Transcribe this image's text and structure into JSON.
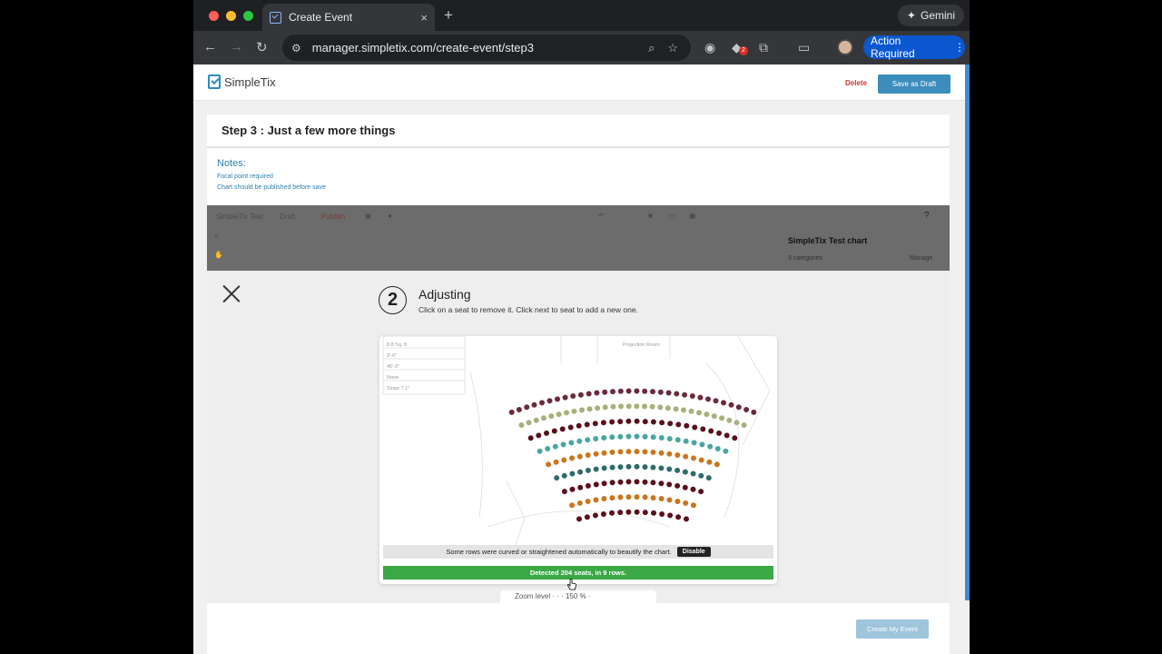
{
  "browser": {
    "tab_title": "Create Event",
    "tab_close": "×",
    "new_tab": "+",
    "gemini_label": "Gemini",
    "url": "manager.simpletix.com/create-event/step3",
    "extension_badge": "2",
    "action_required": "Action Required",
    "traffic_lights": [
      "#ff5f57",
      "#febc2e",
      "#28c840"
    ]
  },
  "header": {
    "logo_text": "SimpleTix",
    "delete_label": "Delete",
    "save_draft_label": "Save as Draft"
  },
  "step": {
    "title": "Step 3 : Just a few more things",
    "notes_heading": "Notes:",
    "notes": [
      "Focal point required",
      "Chart should be published before save"
    ]
  },
  "designer": {
    "app_name": "SimpleTix Test",
    "status": "Draft",
    "publish": "Publish",
    "chart_name": "SimpleTix Test chart",
    "categories": "3 categories",
    "manage": "Manage"
  },
  "wizard": {
    "step_number": "2",
    "title": "Adjusting",
    "subtitle": "Click on a seat to remove it. Click next to seat to add a new one.",
    "curve_notice": "Some rows were curved or straightened automatically to beautify the chart.",
    "disable_label": "Disable",
    "detected": "Detected 204 seats, in 9 rows.",
    "zoom_hint": "Zoom level · · · 150 % ·",
    "blueprint_labels": [
      "8.8 Sq. ft",
      "3'-0\"",
      "45'-0\"",
      "None",
      "Slope 7.1°"
    ],
    "blueprint_heading": "Projection Room"
  },
  "footer": {
    "create_label": "Create My Event"
  },
  "seat_rows": [
    {
      "seats": 32,
      "color": "#6b2a3a"
    },
    {
      "seats": 30,
      "color": "#a7b07c"
    },
    {
      "seats": 26,
      "color": "#5a0f1c"
    },
    {
      "seats": 24,
      "color": "#4aa5a0"
    },
    {
      "seats": 22,
      "color": "#c9761e"
    },
    {
      "seats": 20,
      "color": "#2f6b6b"
    },
    {
      "seats": 18,
      "color": "#5a0f1c"
    },
    {
      "seats": 16,
      "color": "#c9761e"
    },
    {
      "seats": 14,
      "color": "#5a0f1c"
    }
  ],
  "colors": {
    "accent": "#3c8dbc",
    "success": "#3aa845",
    "danger": "#d0342c"
  }
}
